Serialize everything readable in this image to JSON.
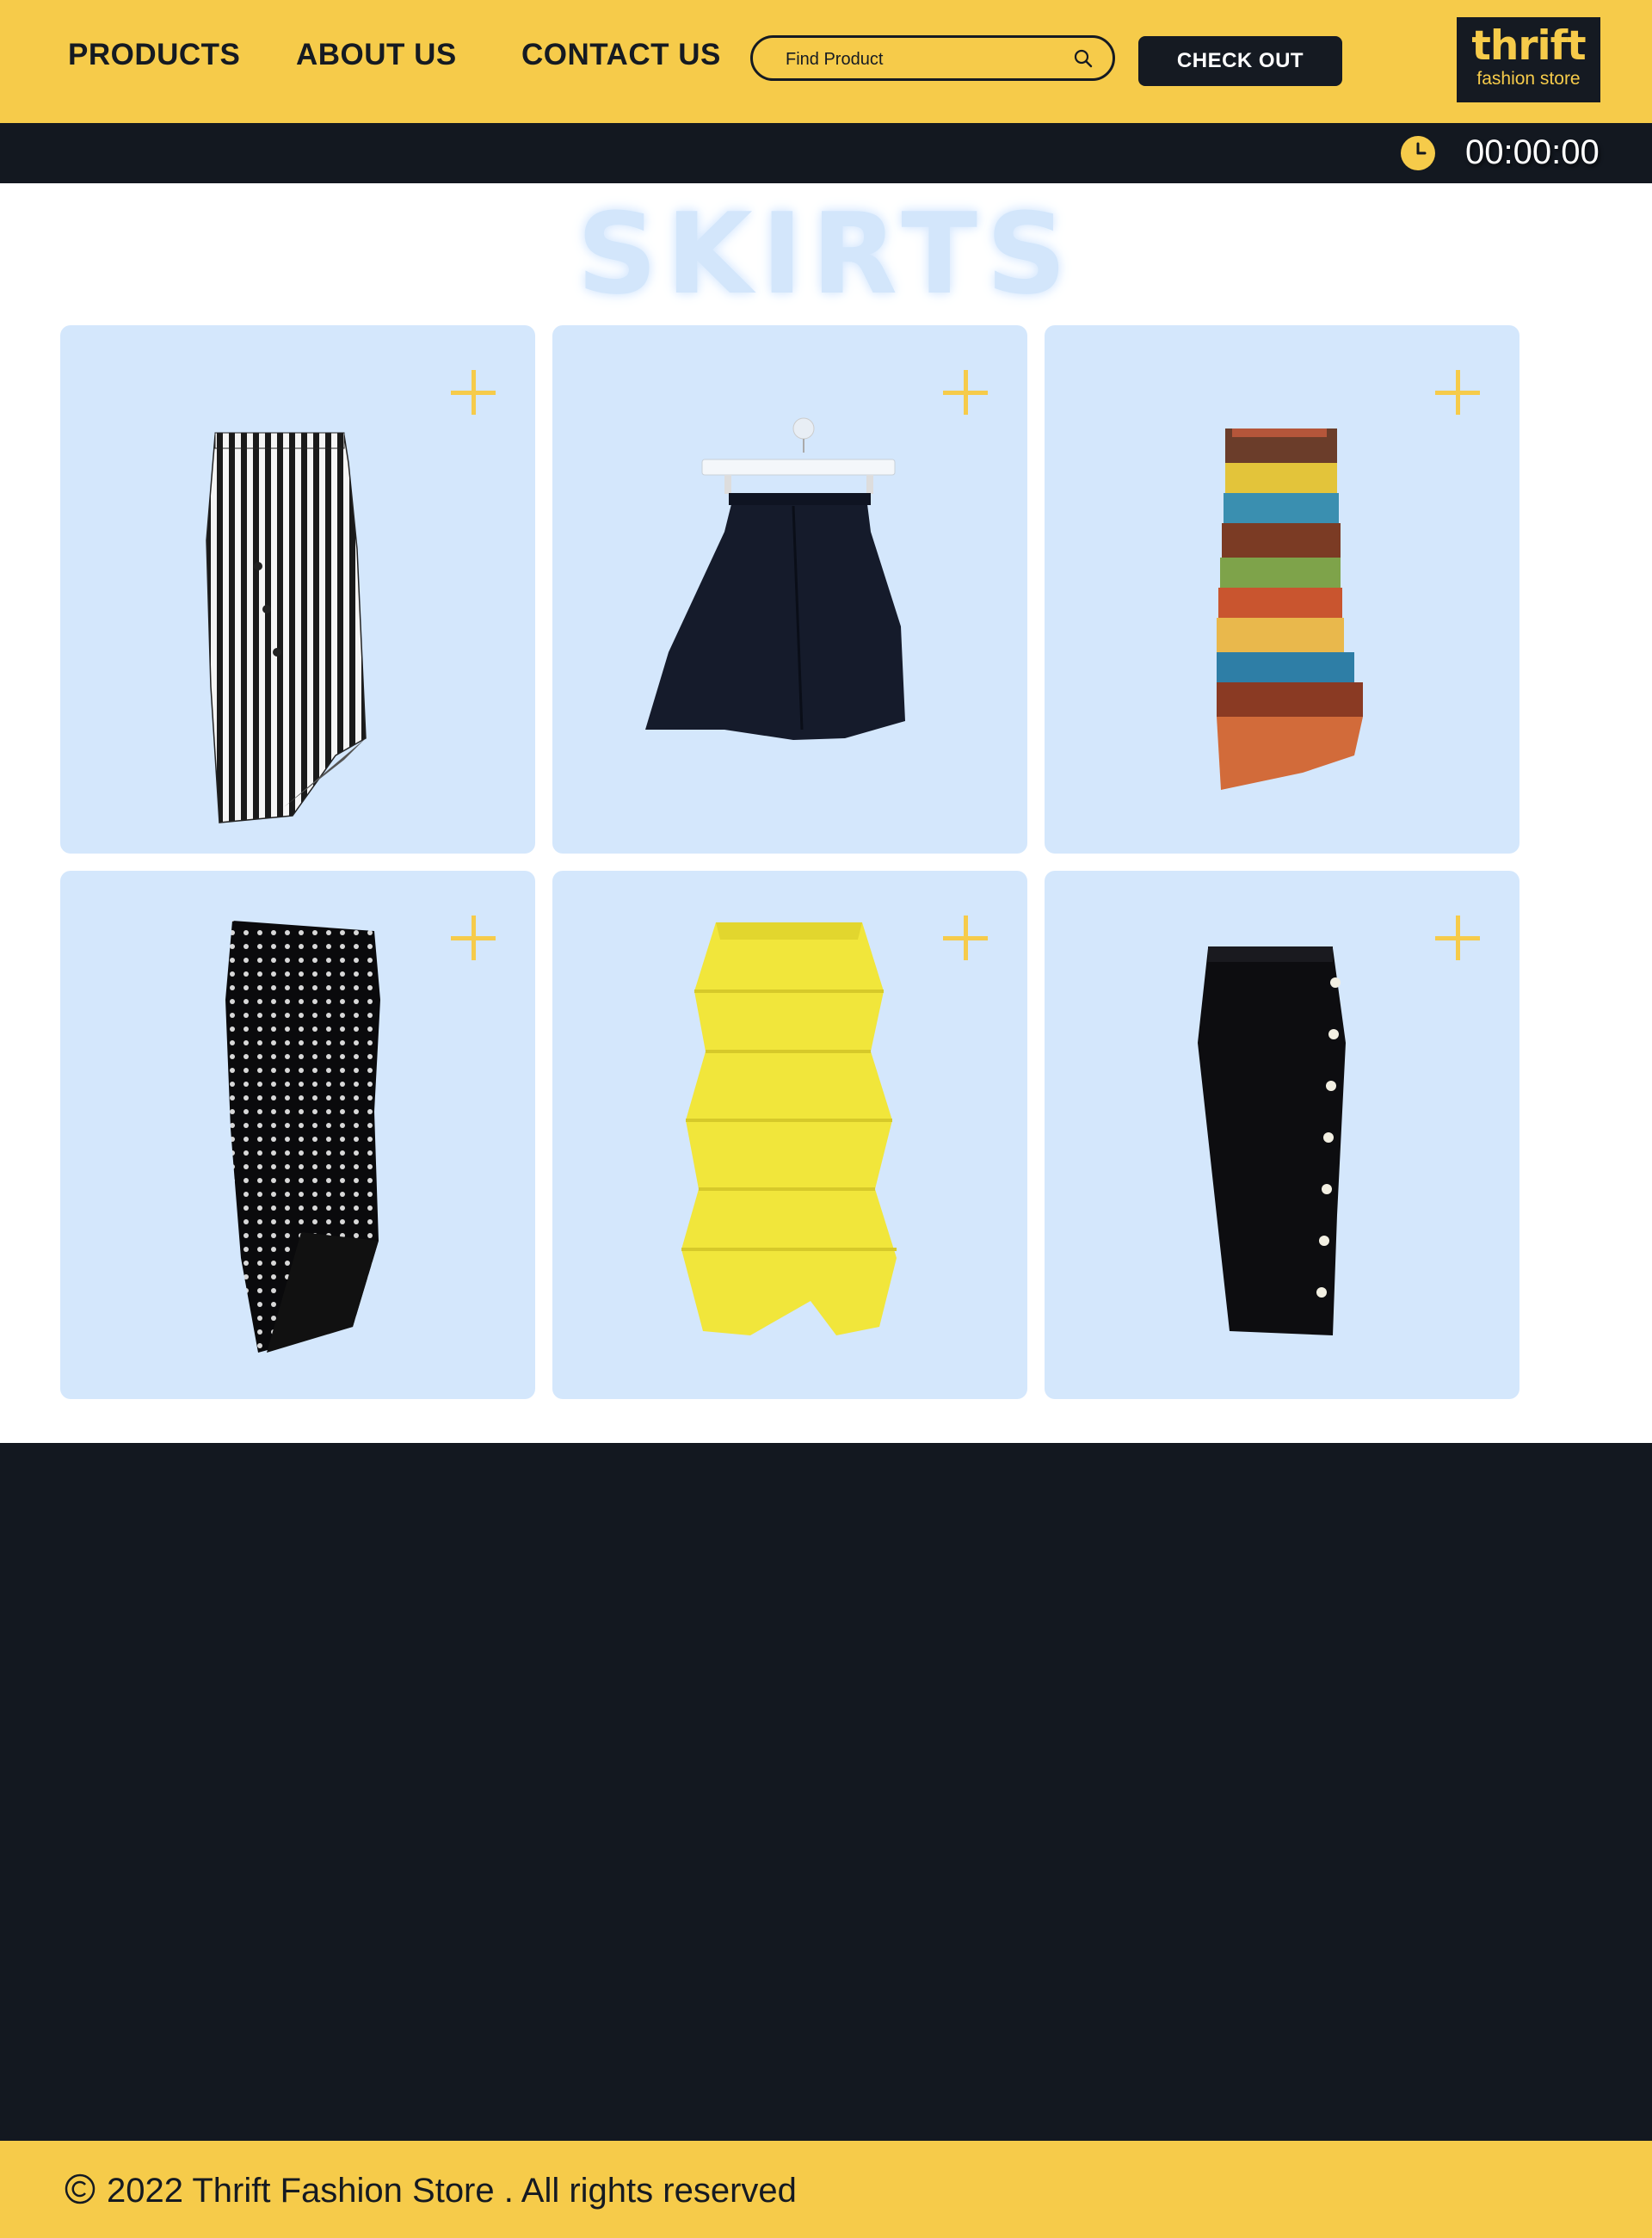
{
  "header": {
    "nav": {
      "products": "PRODUCTS",
      "about": "ABOUT US",
      "contact": "CONTACT US"
    },
    "search": {
      "placeholder": "Find Product",
      "value": ""
    },
    "checkout_label": "CHECK OUT",
    "logo": {
      "main": "thrift",
      "sub": "fashion store"
    }
  },
  "timer": {
    "value": "00:00:00",
    "icon": "clock-icon"
  },
  "title": "SKIRTS",
  "products": [
    {
      "name": "Striped asymmetric skirt",
      "icon": "plus-icon"
    },
    {
      "name": "Navy ruffle mini skirt on hanger",
      "icon": "plus-icon"
    },
    {
      "name": "Multicolor striped knit skirt",
      "icon": "plus-icon"
    },
    {
      "name": "Black studded fringe skirt",
      "icon": "plus-icon"
    },
    {
      "name": "Yellow tiered ruffle skirt",
      "icon": "plus-icon"
    },
    {
      "name": "Black button pencil skirt",
      "icon": "plus-icon"
    }
  ],
  "footer": {
    "text": "2022 Thrift Fashion Store . All rights reserved",
    "icon": "copyright-icon"
  },
  "colors": {
    "accent": "#F6CB4A",
    "dark": "#131820",
    "card": "#D4E7FC"
  }
}
